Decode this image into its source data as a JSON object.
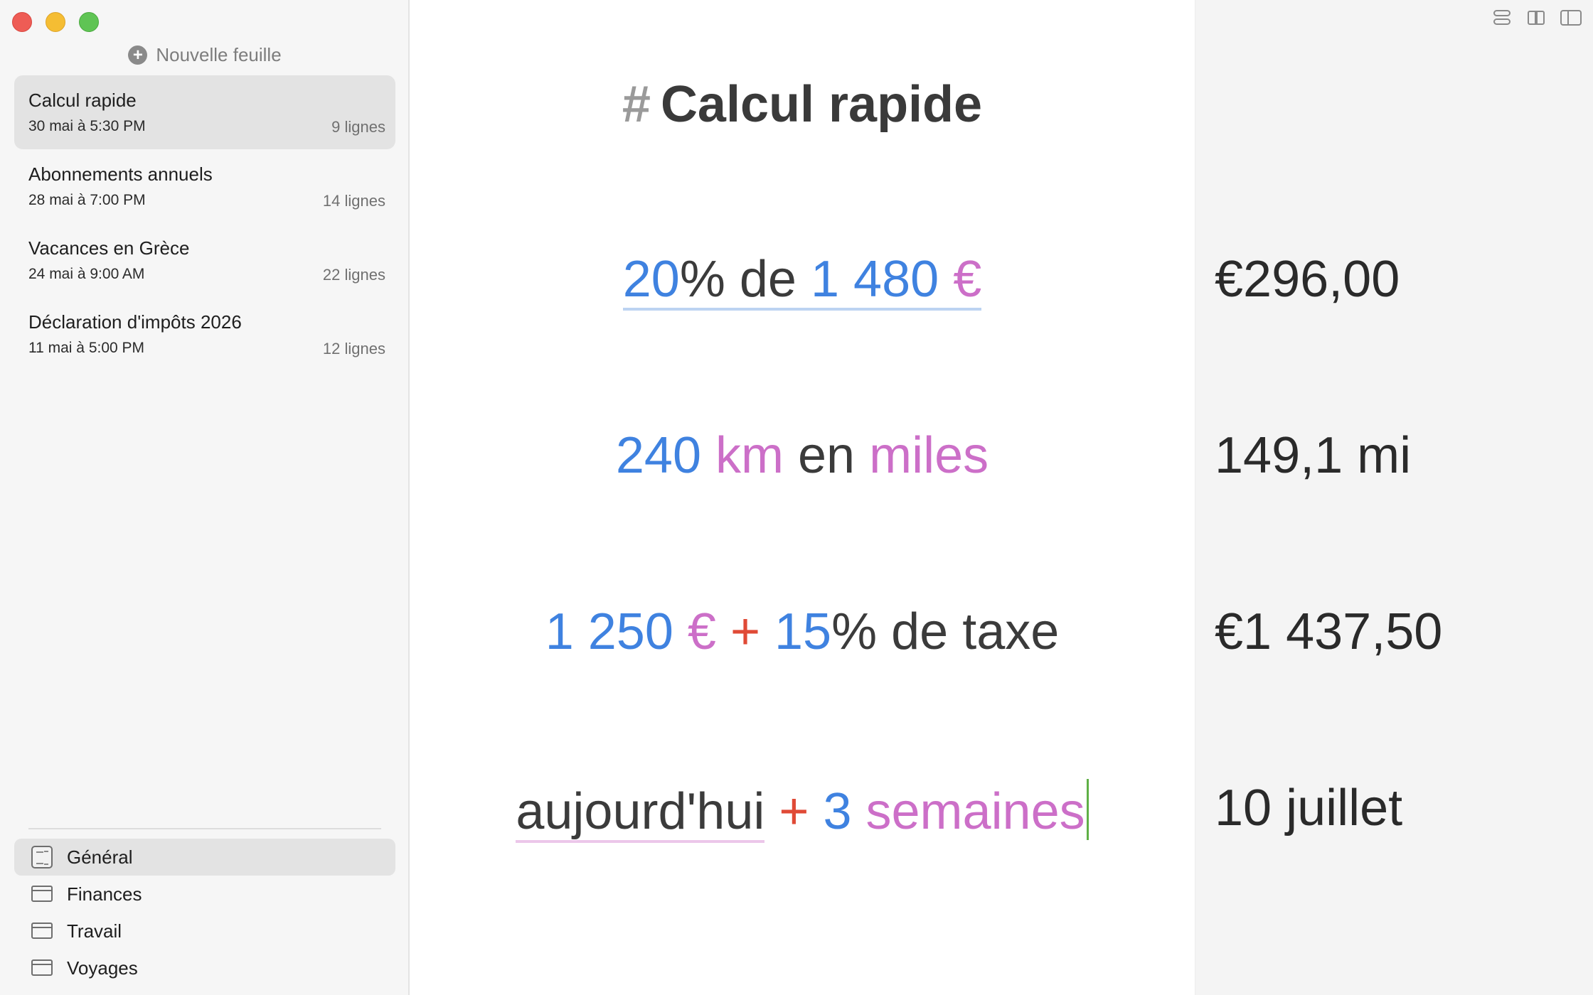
{
  "sidebar": {
    "new_sheet_label": "Nouvelle feuille",
    "sheets": [
      {
        "title": "Calcul rapide",
        "date": "30 mai à 5:30 PM",
        "count": "9 lignes"
      },
      {
        "title": "Abonnements annuels",
        "date": "28 mai à 7:00 PM",
        "count": "14 lignes"
      },
      {
        "title": "Vacances en Grèce",
        "date": "24 mai à 9:00 AM",
        "count": "22 lignes"
      },
      {
        "title": "Déclaration d'impôts 2026",
        "date": "11 mai à 5:00 PM",
        "count": "12 lignes"
      }
    ],
    "folders": [
      {
        "label": "Général",
        "icon": "notebook-icon"
      },
      {
        "label": "Finances",
        "icon": "folder-icon"
      },
      {
        "label": "Travail",
        "icon": "folder-icon"
      },
      {
        "label": "Voyages",
        "icon": "folder-icon"
      }
    ]
  },
  "editor": {
    "heading_hash": "#",
    "heading_text": "Calcul rapide",
    "lines": [
      {
        "parts": [
          "20",
          "% de",
          "1 480",
          "€"
        ]
      },
      {
        "parts": [
          "240",
          "km",
          "en",
          "miles"
        ]
      },
      {
        "parts": [
          "1 250",
          "€",
          "+",
          "15",
          "% de taxe"
        ]
      },
      {
        "parts": [
          "aujourd'hui",
          "+",
          "3",
          "semaines"
        ]
      }
    ]
  },
  "results": {
    "values": [
      "€296,00",
      "149,1 mi",
      "€1 437,50",
      "10 juillet"
    ]
  },
  "toolbar": {
    "icons": [
      "toggles-icon",
      "book-icon",
      "sidebar-icon"
    ]
  },
  "colors": {
    "number": "#3f82e0",
    "unit": "#cc6fc8",
    "operator": "#e04a36",
    "caret": "#5fb046"
  }
}
